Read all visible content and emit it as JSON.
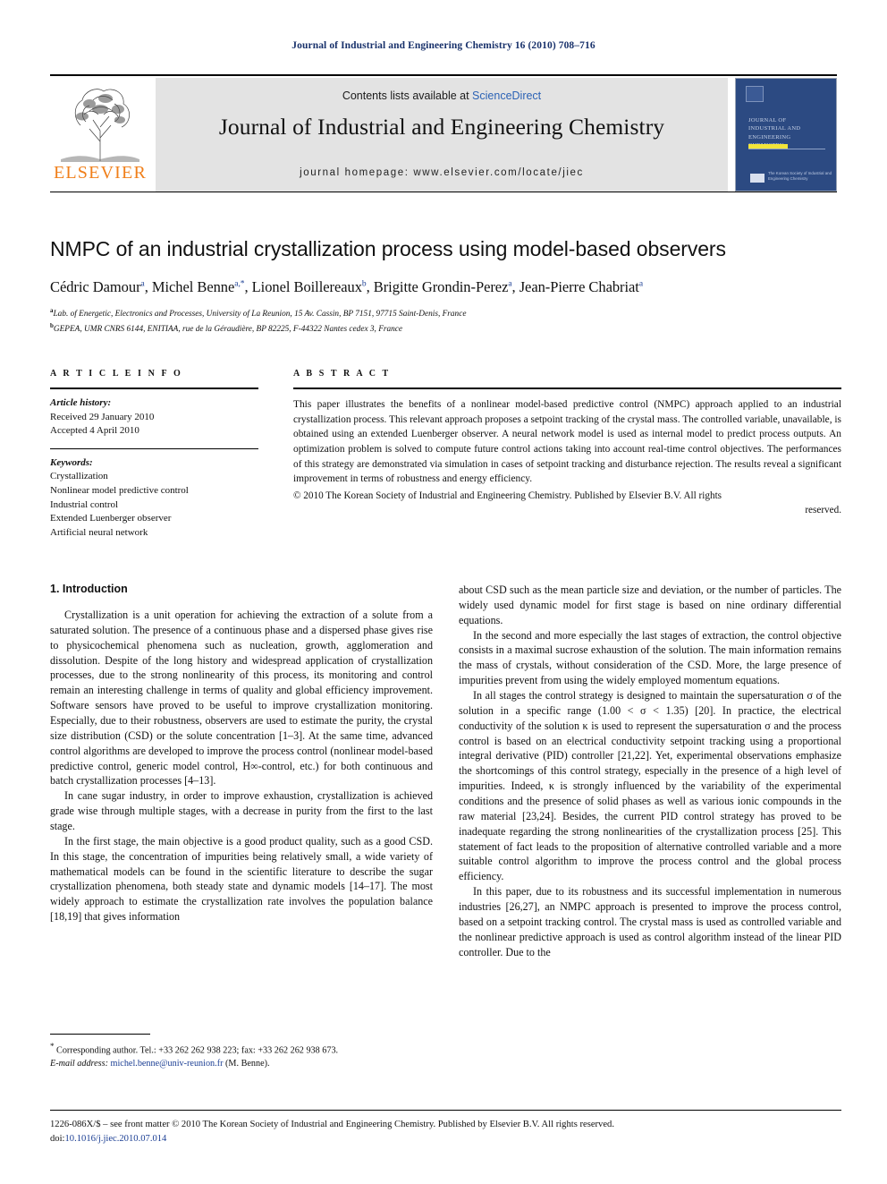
{
  "running_head": "Journal of Industrial and Engineering Chemistry 16 (2010) 708–716",
  "masthead": {
    "contents_prefix": "Contents lists available at ",
    "sciencedirect": "ScienceDirect",
    "journal_title": "Journal of Industrial and Engineering Chemistry",
    "homepage": "journal homepage: www.elsevier.com/locate/jiec",
    "publisher_wordmark": "ELSEVIER",
    "cover": {
      "journal_name": "JOURNAL OF INDUSTRIAL AND ENGINEERING CHEMISTRY",
      "society": "The Korean Society of Industrial and Engineering Chemistry"
    }
  },
  "article": {
    "title": "NMPC of an industrial crystallization process using model-based observers",
    "authors": [
      {
        "name": "Cédric Damour",
        "marks": "a"
      },
      {
        "name": "Michel Benne",
        "marks": "a,*"
      },
      {
        "name": "Lionel Boillereaux",
        "marks": "b"
      },
      {
        "name": "Brigitte Grondin-Perez",
        "marks": "a"
      },
      {
        "name": "Jean-Pierre Chabriat",
        "marks": "a"
      }
    ],
    "affiliations": [
      {
        "mark": "a",
        "text": "Lab. of Energetic, Electronics and Processes, University of La Reunion, 15 Av. Cassin, BP 7151, 97715 Saint-Denis, France"
      },
      {
        "mark": "b",
        "text": "GEPEA, UMR CNRS 6144, ENITIAA, rue de la Géraudière, BP 82225, F-44322 Nantes cedex 3, France"
      }
    ]
  },
  "info": {
    "heading": "A R T I C L E    I N F O",
    "history_label": "Article history:",
    "history": [
      "Received 29 January 2010",
      "Accepted 4 April 2010"
    ],
    "keywords_label": "Keywords:",
    "keywords": [
      "Crystallization",
      "Nonlinear model predictive control",
      "Industrial control",
      "Extended Luenberger observer",
      "Artificial neural network"
    ]
  },
  "abstract": {
    "heading": "A B S T R A C T",
    "text": "This paper illustrates the benefits of a nonlinear model-based predictive control (NMPC) approach applied to an industrial crystallization process. This relevant approach proposes a setpoint tracking of the crystal mass. The controlled variable, unavailable, is obtained using an extended Luenberger observer. A neural network model is used as internal model to predict process outputs. An optimization problem is solved to compute future control actions taking into account real-time control objectives. The performances of this strategy are demonstrated via simulation in cases of setpoint tracking and disturbance rejection. The results reveal a significant improvement in terms of robustness and energy efficiency.",
    "copyright": "© 2010 The Korean Society of Industrial and Engineering Chemistry. Published by Elsevier B.V. All rights",
    "copyright_tail": "reserved."
  },
  "body": {
    "section_title": "1. Introduction",
    "left_paragraphs": [
      "Crystallization is a unit operation for achieving the extraction of a solute from a saturated solution. The presence of a continuous phase and a dispersed phase gives rise to physicochemical phenomena such as nucleation, growth, agglomeration and dissolution. Despite of the long history and widespread application of crystallization processes, due to the strong nonlinearity of this process, its monitoring and control remain an interesting challenge in terms of quality and global efficiency improvement. Software sensors have proved to be useful to improve crystallization monitoring. Especially, due to their robustness, observers are used to estimate the purity, the crystal size distribution (CSD) or the solute concentration [1–3]. At the same time, advanced control algorithms are developed to improve the process control (nonlinear model-based predictive control, generic model control, H∞-control, etc.) for both continuous and batch crystallization processes [4–13].",
      "In cane sugar industry, in order to improve exhaustion, crystallization is achieved grade wise through multiple stages, with a decrease in purity from the first to the last stage.",
      "In the first stage, the main objective is a good product quality, such as a good CSD. In this stage, the concentration of impurities being relatively small, a wide variety of mathematical models can be found in the scientific literature to describe the sugar crystallization phenomena, both steady state and dynamic models [14–17]. The most widely approach to estimate the crystallization rate involves the population balance [18,19] that gives information"
    ],
    "right_paragraphs": [
      "about CSD such as the mean particle size and deviation, or the number of particles. The widely used dynamic model for first stage is based on nine ordinary differential equations.",
      "In the second and more especially the last stages of extraction, the control objective consists in a maximal sucrose exhaustion of the solution. The main information remains the mass of crystals, without consideration of the CSD. More, the large presence of impurities prevent from using the widely employed momentum equations.",
      "In all stages the control strategy is designed to maintain the supersaturation σ of the solution in a specific range (1.00 < σ < 1.35) [20]. In practice, the electrical conductivity of the solution κ is used to represent the supersaturation σ and the process control is based on an electrical conductivity setpoint tracking using a proportional integral derivative (PID) controller [21,22]. Yet, experimental observations emphasize the shortcomings of this control strategy, especially in the presence of a high level of impurities. Indeed, κ is strongly influenced by the variability of the experimental conditions and the presence of solid phases as well as various ionic compounds in the raw material [23,24]. Besides, the current PID control strategy has proved to be inadequate regarding the strong nonlinearities of the crystallization process [25]. This statement of fact leads to the proposition of alternative controlled variable and a more suitable control algorithm to improve the process control and the global process efficiency.",
      "In this paper, due to its robustness and its successful implementation in numerous industries [26,27], an NMPC approach is presented to improve the process control, based on a setpoint tracking control. The crystal mass is used as controlled variable and the nonlinear predictive approach is used as control algorithm instead of the linear PID controller. Due to the"
    ]
  },
  "footnote": {
    "corresponding": "Corresponding author. Tel.: +33 262 262 938 223; fax: +33 262 262 938 673.",
    "email_label": "E-mail address:",
    "email": "michel.benne@univ-reunion.fr",
    "email_suffix": "(M. Benne)."
  },
  "footer": {
    "issn_line": "1226-086X/$ – see front matter © 2010 The Korean Society of Industrial and Engineering Chemistry. Published by Elsevier B.V. All rights reserved.",
    "doi_label": "doi:",
    "doi": "10.1016/j.jiec.2010.07.014"
  },
  "colors": {
    "running_head": "#18316b",
    "link": "#1c3f94",
    "sciencedirect": "#2b62b5",
    "elsevier_orange": "#f07f1a",
    "masthead_band": "#e3e3e3",
    "cover_blue": "#2c4a82"
  }
}
